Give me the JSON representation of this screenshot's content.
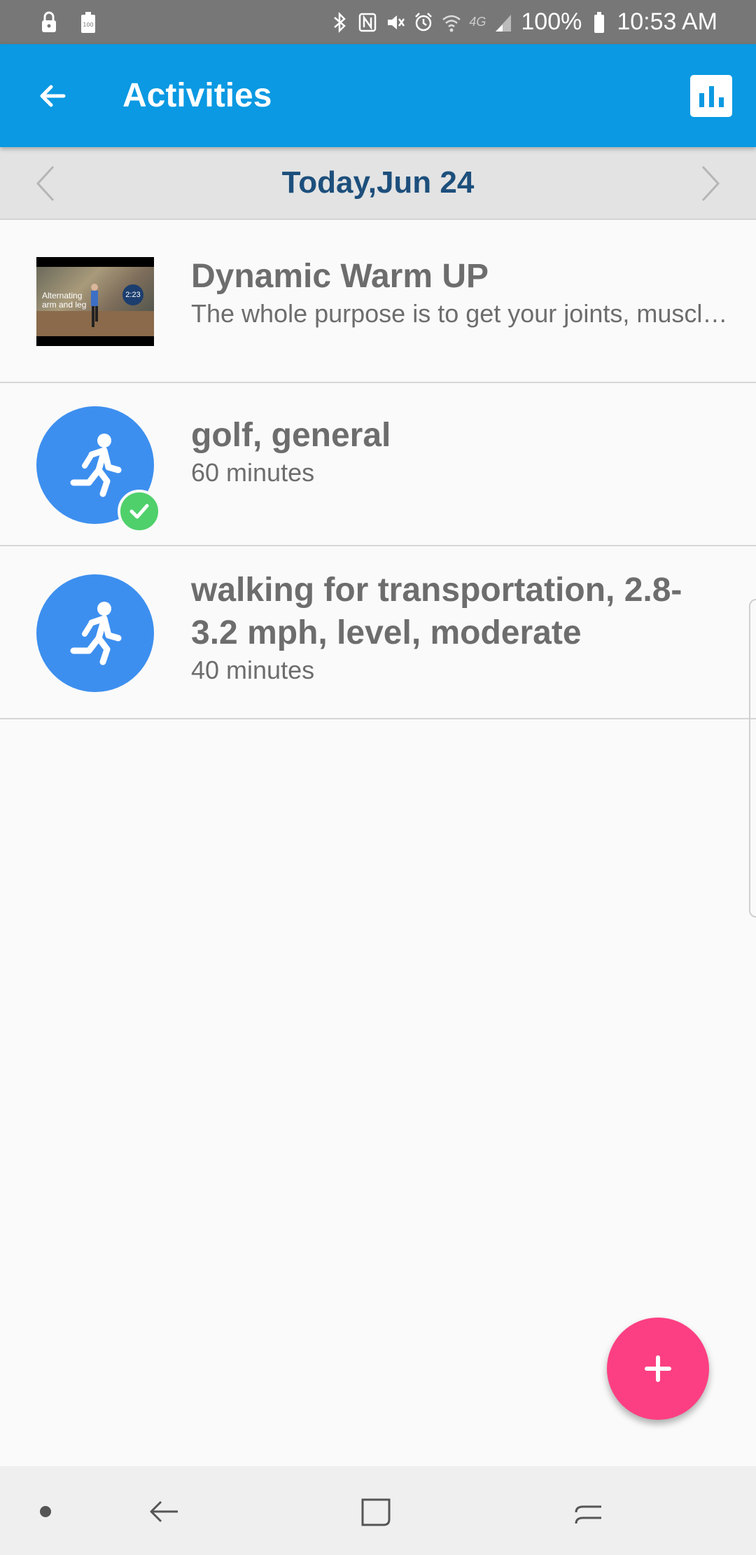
{
  "status_bar": {
    "battery_percent": "100%",
    "time": "10:53 AM",
    "network": "4G",
    "icons_left": [
      "lock-icon",
      "battery-saver-icon"
    ],
    "icons_right": [
      "bluetooth-icon",
      "nfc-icon",
      "mute-icon",
      "alarm-icon",
      "wifi-icon",
      "lte-icon",
      "signal-icon",
      "battery-icon"
    ]
  },
  "app_bar": {
    "title": "Activities",
    "back_icon": "arrow-left-icon",
    "stats_icon": "bar-chart-icon",
    "color": "#0a99e2"
  },
  "date_nav": {
    "label": "Today,Jun 24",
    "prev_icon": "chevron-left-icon",
    "next_icon": "chevron-right-icon"
  },
  "activities": [
    {
      "title": "Dynamic Warm UP",
      "subtitle": "The whole purpose is to get your joints, muscles and tendons warmed up",
      "thumbnail": {
        "caption": "Alternating arm and leg",
        "duration": "2:23"
      },
      "completed": false
    },
    {
      "title": "golf, general",
      "subtitle": "60 minutes",
      "icon": "running-person-icon",
      "completed": true
    },
    {
      "title": "walking for transportation, 2.8-3.2 mph, level, moderate",
      "subtitle": "40 minutes",
      "icon": "running-person-icon",
      "completed": false
    }
  ],
  "fab": {
    "label": "+",
    "color": "#fc3f82"
  },
  "nav_bar": {
    "buttons": [
      "dot-icon",
      "back-icon",
      "home-icon",
      "recents-icon"
    ]
  }
}
